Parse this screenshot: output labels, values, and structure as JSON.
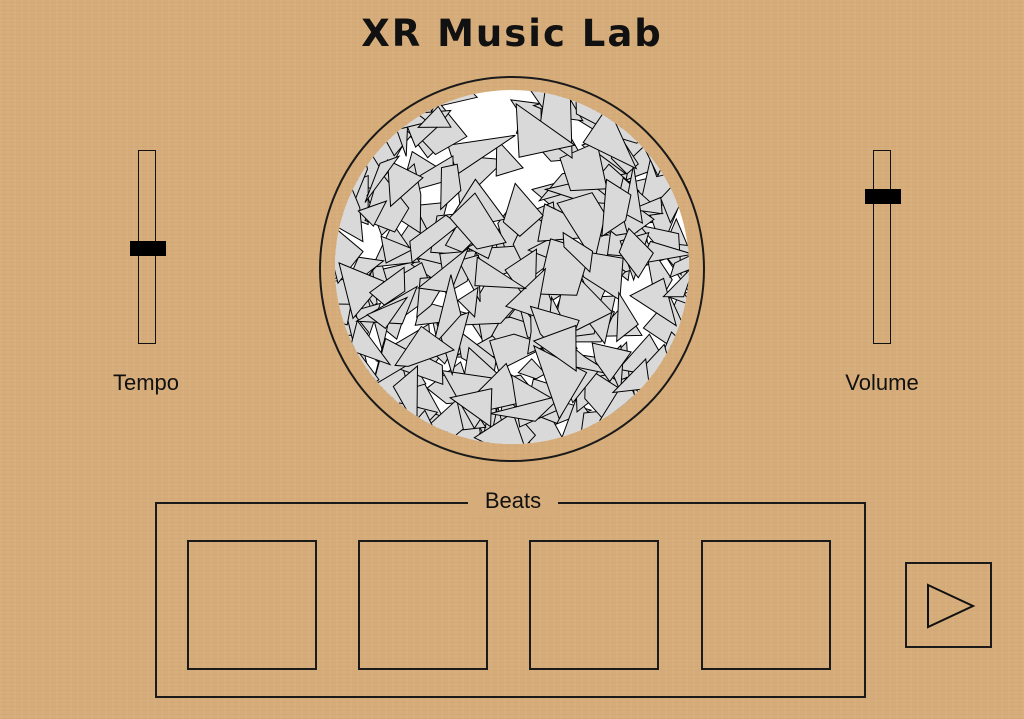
{
  "app": {
    "title": "XR Music Lab"
  },
  "controls": {
    "tempo": {
      "label": "Tempo",
      "level": 0.5
    },
    "volume": {
      "label": "Volume",
      "level": 0.8
    }
  },
  "drum": {
    "icon": "shattered-glass-texture",
    "fill_color": "#d9d9d9",
    "stroke_color": "#000000"
  },
  "beats": {
    "label": "Beats",
    "pads": [
      {
        "id": "beat-1"
      },
      {
        "id": "beat-2"
      },
      {
        "id": "beat-3"
      },
      {
        "id": "beat-4"
      }
    ]
  },
  "play": {
    "icon": "play-triangle-icon"
  },
  "colors": {
    "background": "#d6ad7a",
    "ink": "#111111"
  }
}
